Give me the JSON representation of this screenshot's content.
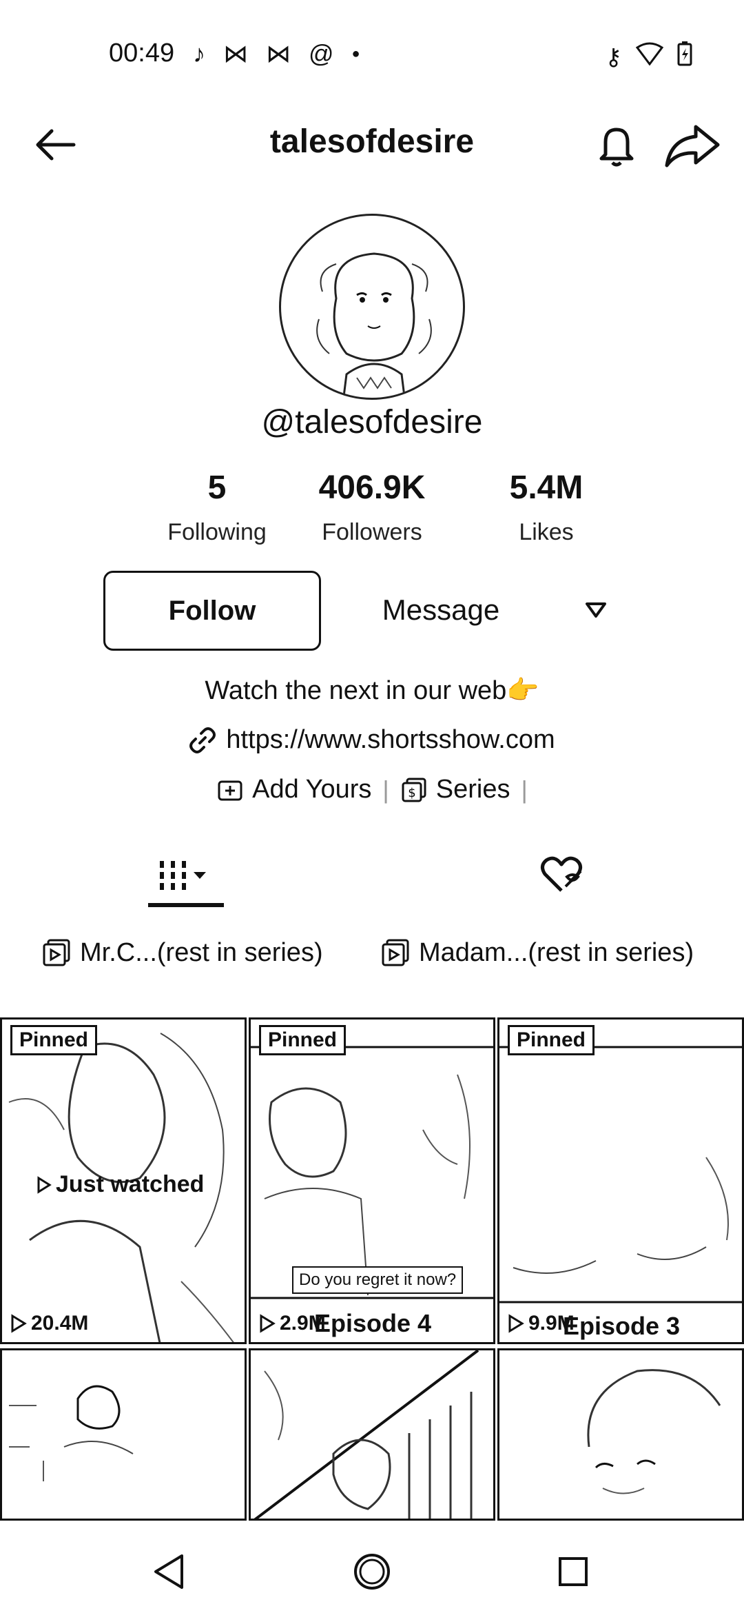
{
  "status_bar": {
    "time": "00:49",
    "left_icons": [
      "tiktok-icon",
      "capcut-icon",
      "capcut-icon",
      "threads-icon",
      "dot-icon"
    ],
    "right_icons": [
      "key-icon",
      "wifi-icon",
      "battery-icon"
    ]
  },
  "header": {
    "title": "talesofdesire",
    "back_icon": "arrow-left-icon",
    "bell_icon": "bell-icon",
    "share_icon": "share-icon"
  },
  "profile": {
    "handle": "@talesofdesire",
    "stats": [
      {
        "value": "5",
        "label": "Following"
      },
      {
        "value": "406.9K",
        "label": "Followers"
      },
      {
        "value": "5.4M",
        "label": "Likes"
      }
    ],
    "follow_label": "Follow",
    "message_label": "Message",
    "bio": "Watch the next in our web👉",
    "link": "https://www.shortsshow.com",
    "chips": [
      {
        "label": "Add Yours",
        "icon": "add-yours-icon"
      },
      {
        "label": "Series",
        "icon": "series-icon"
      }
    ]
  },
  "tabs": {
    "videos_icon": "grid-icon",
    "liked_icon": "liked-hidden-icon"
  },
  "series_row": [
    {
      "label": "Mr.C...(rest in series)",
      "icon": "playlist-icon"
    },
    {
      "label": "Madam...(rest in series)",
      "icon": "playlist-icon"
    }
  ],
  "videos": [
    {
      "pinned": "Pinned",
      "views": "20.4M",
      "overlay": "Just watched",
      "caption": "",
      "subtitle": ""
    },
    {
      "pinned": "Pinned",
      "views": "2.9M",
      "overlay": "",
      "caption": "Episode 4",
      "subtitle": "Do you regret it now?"
    },
    {
      "pinned": "Pinned",
      "views": "9.9M",
      "overlay": "",
      "caption": "Episode 3",
      "subtitle": ""
    },
    {
      "pinned": "",
      "views": "",
      "overlay": "",
      "caption": "",
      "subtitle": ""
    },
    {
      "pinned": "",
      "views": "",
      "overlay": "",
      "caption": "",
      "subtitle": ""
    },
    {
      "pinned": "",
      "views": "",
      "overlay": "",
      "caption": "",
      "subtitle": ""
    }
  ],
  "nav_bar": {
    "back": "nav-back-icon",
    "home": "nav-home-icon",
    "recents": "nav-recents-icon"
  }
}
